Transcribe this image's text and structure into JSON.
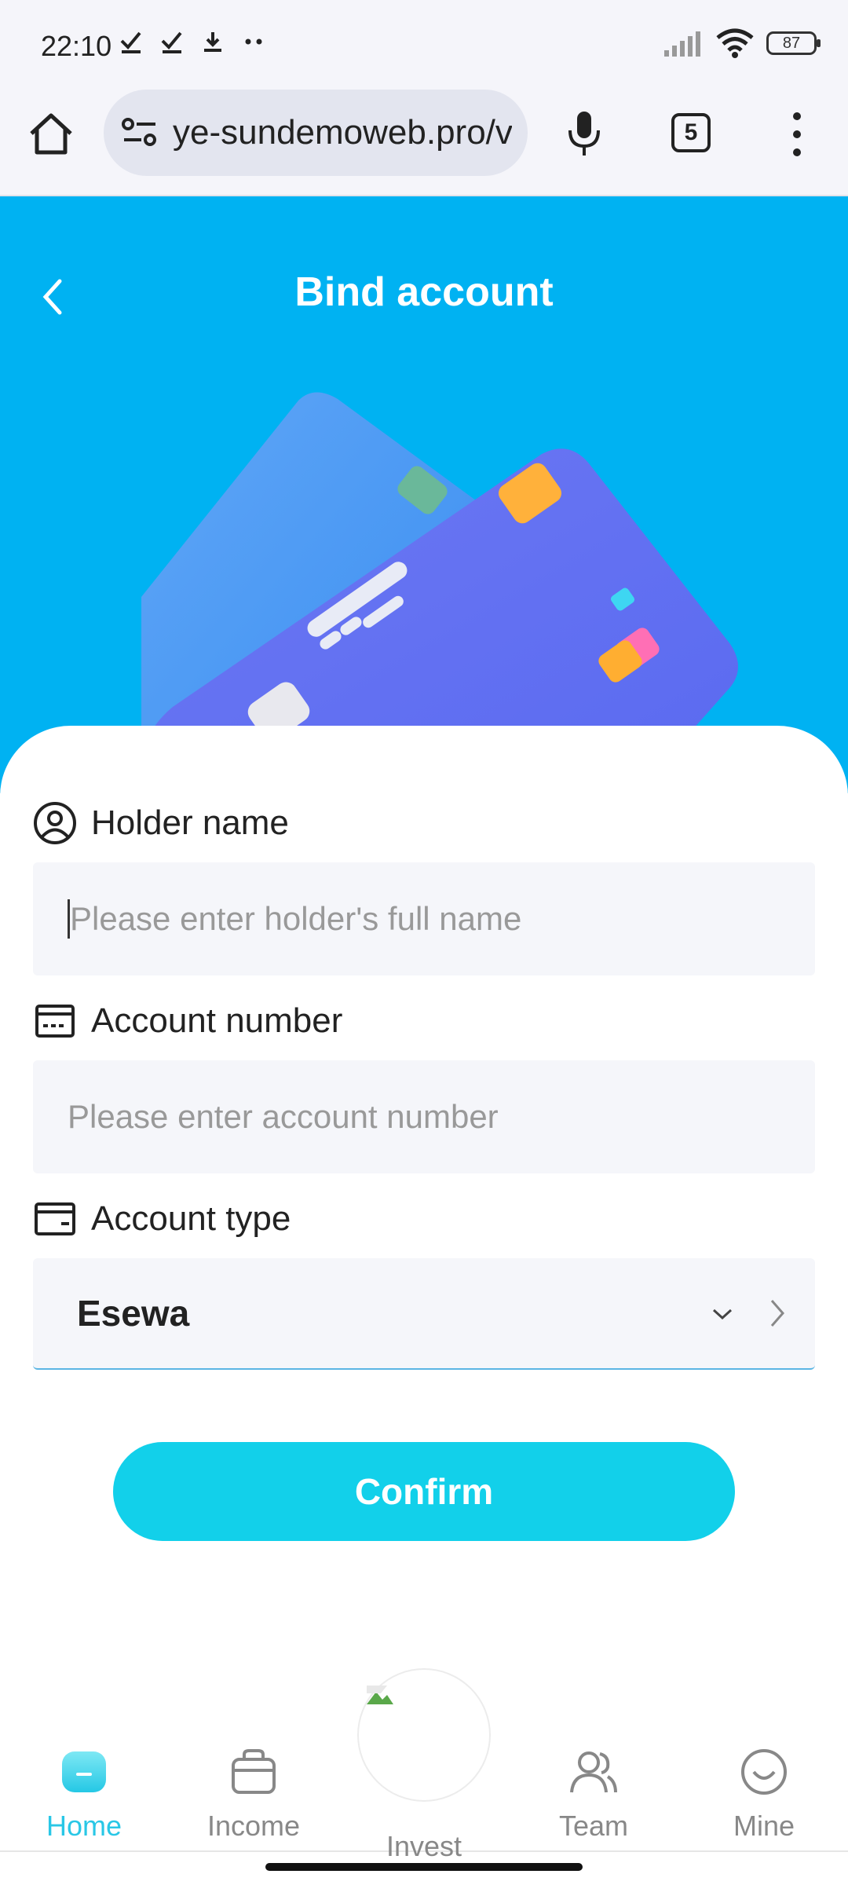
{
  "status_bar": {
    "time": "22:10",
    "battery": "87",
    "icons": [
      "check-icon",
      "check-icon",
      "download-icon",
      "more-dots-icon",
      "signal-icon",
      "wifi-icon",
      "battery-icon"
    ]
  },
  "browser": {
    "url": "ye-sundemoweb.pro/v",
    "tab_count": "5",
    "icons": [
      "home-icon",
      "site-settings-icon",
      "mic-icon",
      "tabs-icon",
      "menu-icon"
    ]
  },
  "header": {
    "title": "Bind account",
    "back_icon": "chevron-left-icon"
  },
  "form": {
    "holder_name": {
      "label": "Holder name",
      "placeholder": "Please enter holder's full name",
      "value": "",
      "icon": "user-circle-icon"
    },
    "account_number": {
      "label": "Account number",
      "placeholder": "Please enter account number",
      "value": "",
      "icon": "card-icon"
    },
    "account_type": {
      "label": "Account type",
      "value": "Esewa",
      "icon": "wallet-icon"
    },
    "confirm_label": "Confirm"
  },
  "nav": {
    "items": [
      {
        "label": "Home",
        "icon": "home-icon",
        "active": true
      },
      {
        "label": "Income",
        "icon": "bag-icon",
        "active": false
      },
      {
        "label": "Invest",
        "icon": "broken-image-icon",
        "active": false
      },
      {
        "label": "Team",
        "icon": "users-icon",
        "active": false
      },
      {
        "label": "Mine",
        "icon": "smile-icon",
        "active": false
      }
    ]
  },
  "colors": {
    "hero": "#00b2f2",
    "accent": "#29c7e6",
    "button": "#12d0ea"
  }
}
